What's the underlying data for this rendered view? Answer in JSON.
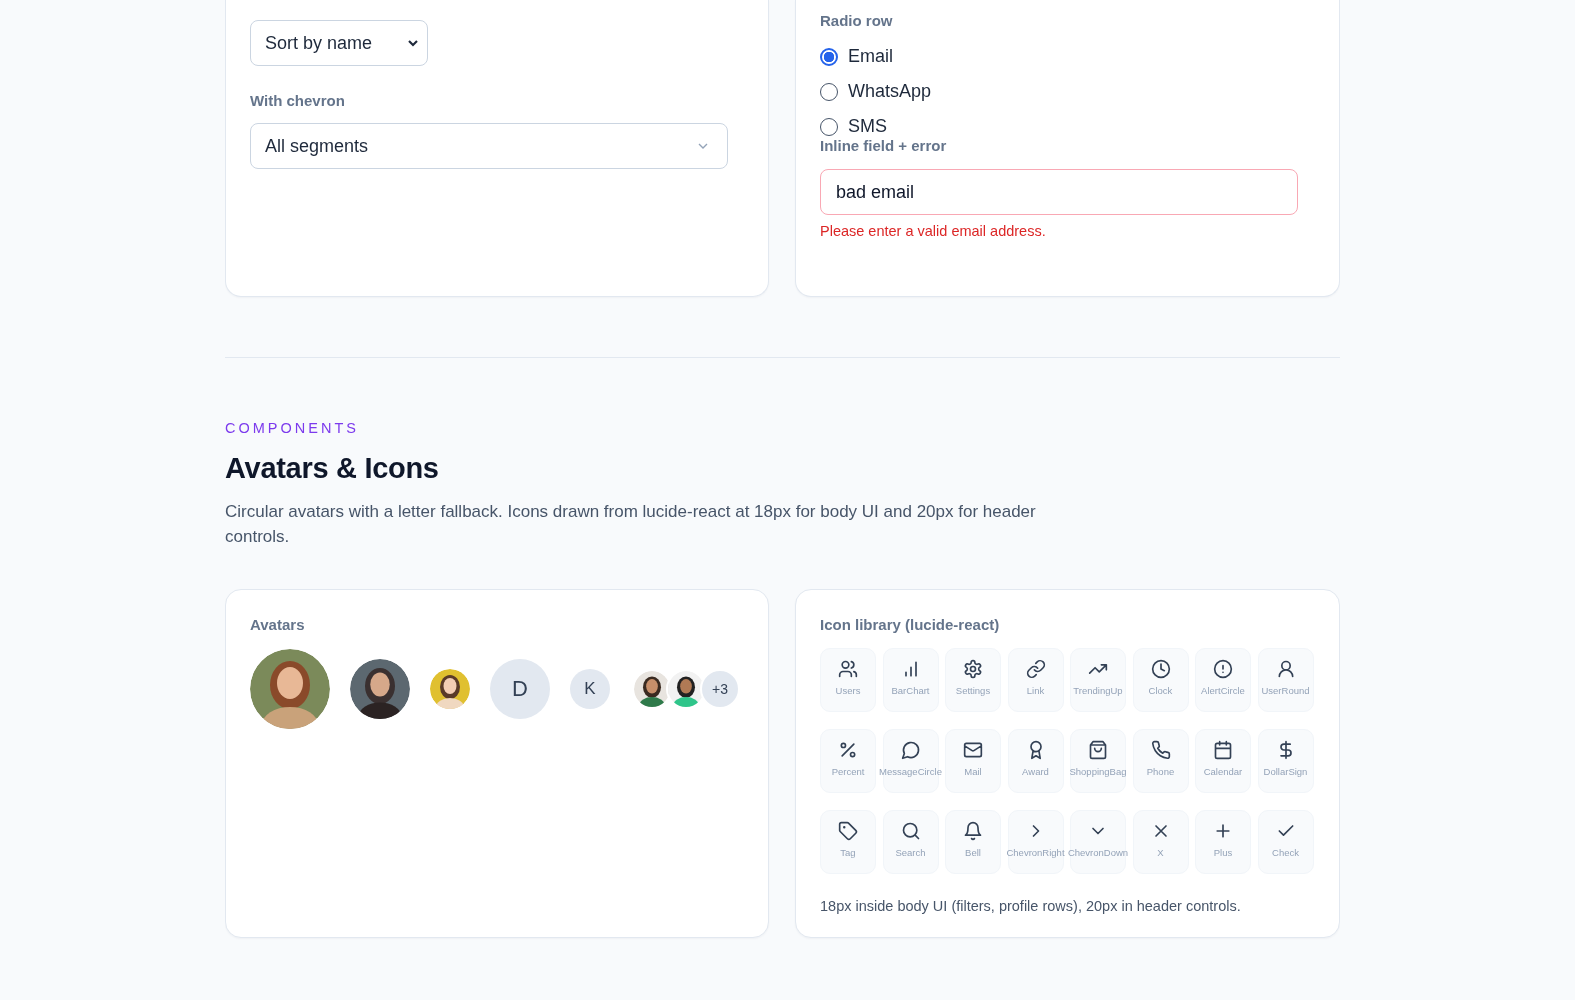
{
  "dropdowns": [
    {
      "value": "Sort by name",
      "kind": "native"
    },
    {
      "label": "With chevron",
      "value": "All segments",
      "kind": "chevron"
    }
  ],
  "radio_row": {
    "label": "Radio row",
    "options": [
      {
        "label": "Email",
        "selected": true
      },
      {
        "label": "WhatsApp",
        "selected": false
      },
      {
        "label": "SMS",
        "selected": false
      }
    ]
  },
  "inline_field": {
    "label": "Inline field + error",
    "value": "bad email",
    "invalid": true,
    "error": "Please enter a valid email address."
  },
  "section": {
    "eyebrow": "COMPONENTS",
    "title": "Avatars & Icons",
    "description": "Circular avatars with a letter fallback. Icons drawn from lucide-react at 18px for body UI and 20px for header controls."
  },
  "avatars": {
    "label": "Avatars",
    "items": [
      {
        "kind": "picture"
      },
      {
        "kind": "picture"
      },
      {
        "kind": "picture"
      },
      {
        "kind": "initial",
        "text": "D"
      },
      {
        "kind": "initial",
        "text": "K"
      },
      {
        "kind": "group",
        "members": [
          {
            "kind": "picture"
          },
          {
            "kind": "picture"
          }
        ],
        "more": "+3"
      }
    ]
  },
  "icon_library": {
    "label": "Icon library (lucide-react)",
    "icons": [
      "Users",
      "BarChart",
      "Settings",
      "Link",
      "TrendingUp",
      "Clock",
      "AlertCircle",
      "UserRound",
      "Percent",
      "MessageCircle",
      "Mail",
      "Award",
      "ShoppingBag",
      "Phone",
      "Calendar",
      "DollarSign",
      "Tag",
      "Search",
      "Bell",
      "ChevronRight",
      "ChevronDown",
      "X",
      "Plus",
      "Check"
    ],
    "caption": "18px inside body UI (filters, profile rows), 20px in header controls."
  }
}
